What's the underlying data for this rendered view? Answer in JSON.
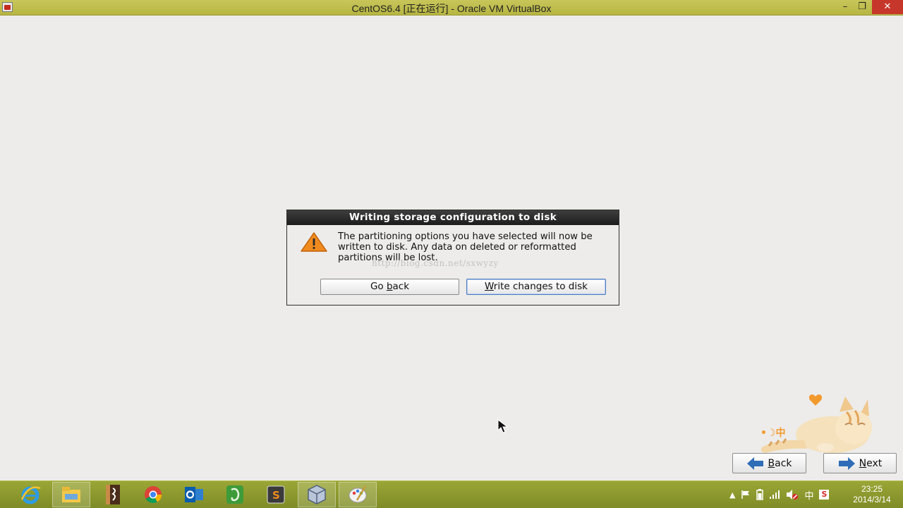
{
  "window": {
    "title": "CentOS6.4 [正在运行] - Oracle VM VirtualBox",
    "minimize_glyph": "–",
    "maximize_glyph": "❐",
    "close_glyph": "✕"
  },
  "dialog": {
    "title": "Writing storage configuration to disk",
    "message": "The partitioning options you have selected will now be written to disk.  Any data on deleted or reformatted partitions will be lost.",
    "watermark": "http://blog.csdn.net/sxwyzy",
    "go_back": {
      "pre": "Go ",
      "mnemonic": "b",
      "post": "ack"
    },
    "write_changes": {
      "pre": "",
      "mnemonic": "W",
      "post": "rite changes to disk"
    }
  },
  "mascot": {
    "label": "•☽中"
  },
  "nav": {
    "back": {
      "mnemonic": "B",
      "post": "ack"
    },
    "next": {
      "mnemonic": "N",
      "post": "ext"
    }
  },
  "taskbar": {
    "items": [
      "ie-icon",
      "file-explorer-icon",
      "notebook-icon",
      "chrome-icon",
      "outlook-icon",
      "evernote-icon",
      "sublime-icon",
      "virtualbox-icon",
      "paint-icon"
    ],
    "tray": {
      "ime": "中",
      "sogou": "S"
    },
    "clock": {
      "time": "23:25",
      "date": "2014/3/14"
    }
  },
  "colors": {
    "titlebar": "#b7b542",
    "taskbar": "#8b9830",
    "dialog_title": "#2a2a2a",
    "close": "#c7362b",
    "nav_arrow": "#2f6db6"
  }
}
